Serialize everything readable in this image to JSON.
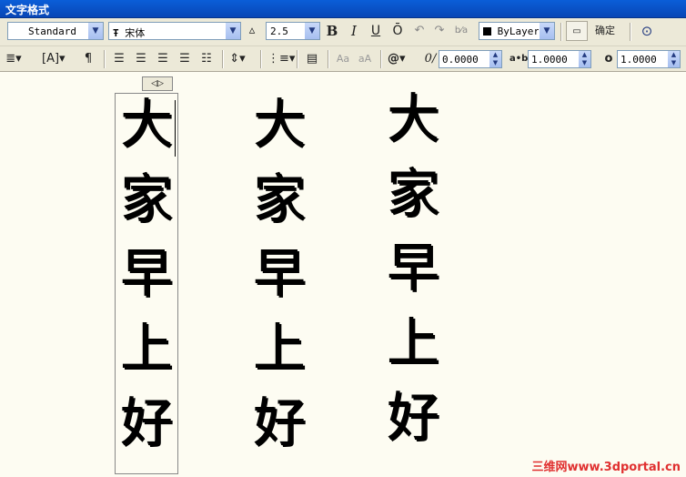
{
  "window": {
    "title": "文字格式"
  },
  "toolbar": {
    "style": "Standard",
    "font": "宋体",
    "height": "2.5",
    "bold_label": "B",
    "italic_label": "I",
    "underline_label": "U",
    "overline_label": "Ō",
    "color": "ByLayer",
    "ok_label": "确定",
    "oblique_value": "0.0000",
    "tracking_value": "1.0000",
    "width_value": "1.0000"
  },
  "content": {
    "columns": [
      [
        "大",
        "家",
        "早",
        "上",
        "好"
      ],
      [
        "大",
        "家",
        "早",
        "上",
        "好"
      ],
      [
        "大",
        "家",
        "早",
        "上",
        "好"
      ]
    ]
  },
  "watermark": "三维网www.3dportal.cn",
  "colors": {
    "titlebar": "#0a5ed8",
    "toolbar": "#ece9d8",
    "canvas": "#fdfcf2",
    "watermark": "#e03030"
  }
}
